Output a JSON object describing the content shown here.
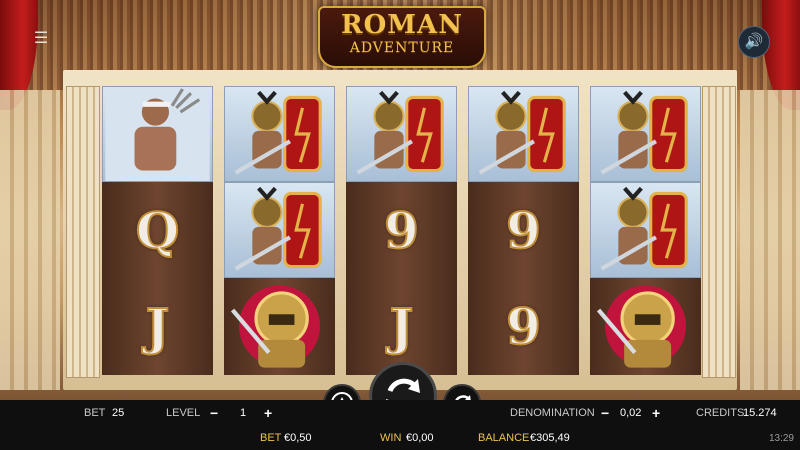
{
  "logo": {
    "line1": "ROMAN",
    "line2": "ADVENTURE"
  },
  "controls": {
    "menu_icon": "menu-icon",
    "sound_icon": "speaker-icon",
    "spin_icon": "spin-arrows-icon",
    "autoplay_icon": "autoplay-icon",
    "turbo_icon": "turbo-icon"
  },
  "reels": [
    [
      "gladiator-trident",
      "Q",
      "J"
    ],
    [
      "gladiator-shield",
      "gladiator-shield",
      "golden-helmet"
    ],
    [
      "gladiator-shield",
      "9",
      "J"
    ],
    [
      "gladiator-shield",
      "9",
      "9"
    ],
    [
      "gladiator-shield",
      "gladiator-shield",
      "golden-helmet"
    ]
  ],
  "bar": {
    "bet_label": "BET",
    "bet_value": "25",
    "level_label": "LEVEL",
    "level_minus": "−",
    "level_value": "1",
    "level_plus": "+",
    "denomination_label": "DENOMINATION",
    "denom_minus": "−",
    "denomination_value": "0,02",
    "denom_plus": "+",
    "credits_label": "CREDITS",
    "credits_value": "15.274",
    "bet_money_label": "BET",
    "bet_money_value": "€0,50",
    "win_label": "WIN",
    "win_value": "€0,00",
    "balance_label": "BALANCE",
    "balance_value": "€305,49",
    "clock": "13:29"
  },
  "colors": {
    "gold": "#f2c14e",
    "bar_bg": "#0f0f0f",
    "reel_bg": "#5a3624"
  }
}
